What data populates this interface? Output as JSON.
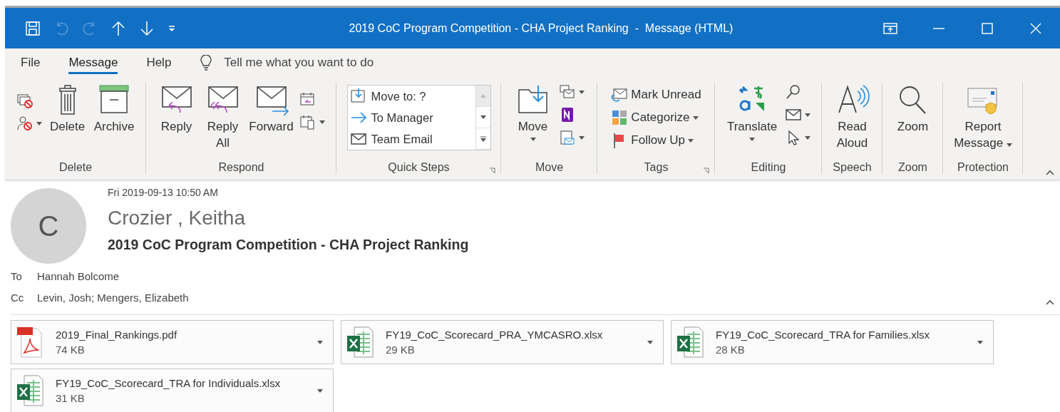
{
  "window": {
    "title": "2019 CoC Program Competition - CHA Project Ranking  -  Message (HTML)"
  },
  "quick_access": [
    {
      "kind": "save",
      "disabled": false
    },
    {
      "kind": "undo",
      "disabled": true
    },
    {
      "kind": "redo",
      "disabled": true
    },
    {
      "kind": "up",
      "disabled": false
    },
    {
      "kind": "down",
      "disabled": false
    },
    {
      "kind": "customize",
      "disabled": false
    }
  ],
  "menu_tabs": [
    {
      "label": "File",
      "selected": false
    },
    {
      "label": "Message",
      "selected": true
    },
    {
      "label": "Help",
      "selected": false
    }
  ],
  "tell_me": {
    "placeholder": "Tell me what you want to do"
  },
  "ribbon_groups": [
    {
      "kind": "delete",
      "label": "Delete",
      "launcher": false,
      "buttons": [
        {
          "label": "Delete",
          "dropdown": false
        },
        {
          "label": "Archive",
          "dropdown": false
        }
      ]
    },
    {
      "kind": "respond",
      "label": "Respond",
      "launcher": false,
      "buttons": [
        {
          "label": "Reply",
          "dropdown": false
        },
        {
          "label": "Reply All",
          "dropdown": false
        },
        {
          "label": "Forward",
          "dropdown": false
        }
      ]
    },
    {
      "kind": "quick_steps",
      "label": "Quick Steps",
      "launcher": true,
      "steps": [
        "Move to: ?",
        "To Manager",
        "Team Email"
      ]
    },
    {
      "kind": "move",
      "label": "Move",
      "launcher": false,
      "buttons": [
        {
          "label": "Move",
          "dropdown": true
        }
      ]
    },
    {
      "kind": "tags",
      "label": "Tags",
      "launcher": true,
      "buttons": [
        {
          "label": "Mark Unread",
          "dropdown": false
        },
        {
          "label": "Categorize",
          "dropdown": true
        },
        {
          "label": "Follow Up",
          "dropdown": true
        }
      ]
    },
    {
      "kind": "editing",
      "label": "Editing",
      "launcher": false,
      "buttons": [
        {
          "label": "Translate",
          "dropdown": true
        }
      ]
    },
    {
      "kind": "speech",
      "label": "Speech",
      "launcher": false,
      "buttons": [
        {
          "label": "Read Aloud",
          "dropdown": false
        }
      ]
    },
    {
      "kind": "zoom",
      "label": "Zoom",
      "launcher": false,
      "buttons": [
        {
          "label": "Zoom",
          "dropdown": false
        }
      ]
    },
    {
      "kind": "protection",
      "label": "Protection",
      "launcher": false,
      "buttons": [
        {
          "label": "Report Message",
          "dropdown": true
        }
      ]
    }
  ],
  "message": {
    "avatar_initial": "C",
    "date": "Fri 2019-09-13 10:50 AM",
    "sender": "Crozier , Keitha",
    "subject": "2019 CoC Program Competition - CHA Project Ranking",
    "recipients": [
      {
        "label": "To",
        "value": "Hannah Bolcome"
      },
      {
        "label": "Cc",
        "value": "Levin, Josh; Mengers, Elizabeth"
      }
    ],
    "attachments": [
      {
        "kind": "pdf",
        "name": "2019_Final_Rankings.pdf",
        "size": "74 KB"
      },
      {
        "kind": "xlsx",
        "name": "FY19_CoC_Scorecard_PRA_YMCASRO.xlsx",
        "size": "29 KB"
      },
      {
        "kind": "xlsx",
        "name": "FY19_CoC_Scorecard_TRA for Families.xlsx",
        "size": "28 KB"
      },
      {
        "kind": "xlsx",
        "name": "FY19_CoC_Scorecard_TRA for Individuals.xlsx",
        "size": "31 KB"
      }
    ]
  }
}
